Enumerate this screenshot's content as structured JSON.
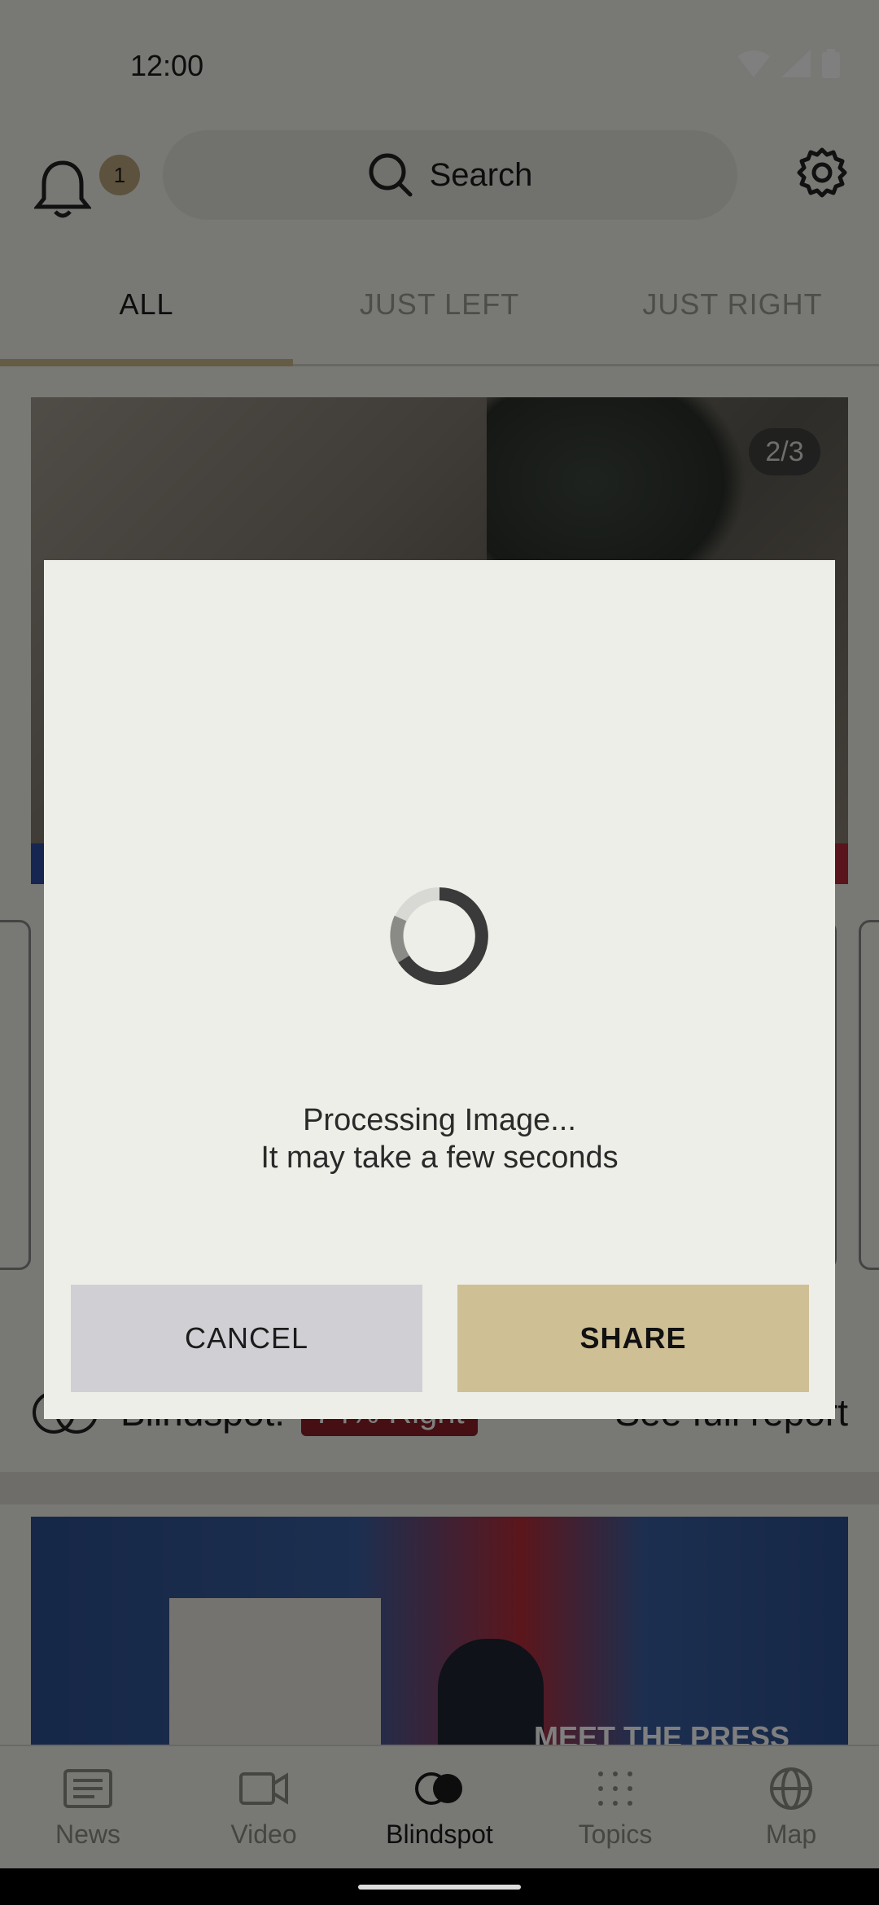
{
  "status_bar": {
    "time": "12:00"
  },
  "header": {
    "notification_count": "1",
    "search_label": "Search"
  },
  "tabs": [
    {
      "label": "ALL",
      "active": true
    },
    {
      "label": "JUST LEFT",
      "active": false
    },
    {
      "label": "JUST RIGHT",
      "active": false
    }
  ],
  "feed": {
    "card1_pager": "2/3",
    "blindspot_label": "Blindspot:",
    "blindspot_value": "74% Right",
    "full_report": "See full report",
    "card2_overlay": "MEET THE PRESS"
  },
  "dialog": {
    "line1": "Processing Image...",
    "line2": "It may take a few seconds",
    "cancel_label": "CANCEL",
    "share_label": "SHARE"
  },
  "bottom_nav": [
    {
      "label": "News",
      "icon": "news-icon",
      "active": false
    },
    {
      "label": "Video",
      "icon": "video-icon",
      "active": false
    },
    {
      "label": "Blindspot",
      "icon": "blindspot-icon",
      "active": true
    },
    {
      "label": "Topics",
      "icon": "topics-icon",
      "active": false
    },
    {
      "label": "Map",
      "icon": "globe-icon",
      "active": false
    }
  ],
  "colors": {
    "accent": "#c9b88a",
    "share_button": "#cfbf95",
    "cancel_button": "#d0cfd4",
    "blindspot_pill": "#8b1f27"
  }
}
